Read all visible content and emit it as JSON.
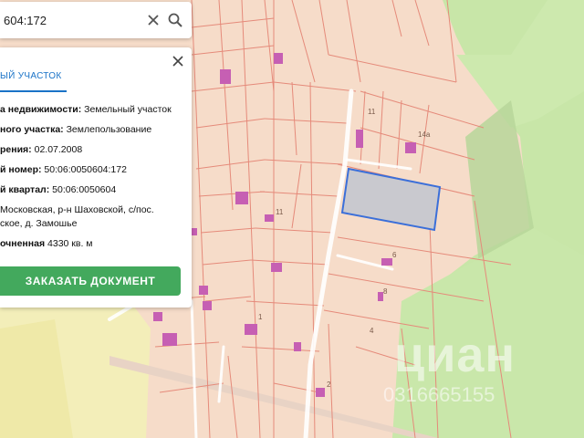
{
  "search": {
    "value": "604:172"
  },
  "card": {
    "tab_label": "ЫЙ УЧАСТОК",
    "rows": [
      {
        "key": "а недвижимости:",
        "value": " Земельный участок"
      },
      {
        "key": "ного участка:",
        "value": " Землепользование"
      },
      {
        "key": "рения:",
        "value": " 02.07.2008"
      },
      {
        "key": "й номер:",
        "value": " 50:06:0050604:172"
      },
      {
        "key": "й квартал:",
        "value": " 50:06:0050604"
      },
      {
        "key": "",
        "value": "Московская, р-н Шаховской, с/пос."
      },
      {
        "key": "",
        "value": "ское, д. Замошье"
      },
      {
        "key": "очненная",
        "value": "  4330 кв. м"
      }
    ],
    "button_label": "ЗАКАЗАТЬ ДОКУМЕНТ"
  },
  "map": {
    "plot_labels": [
      "11",
      "14а",
      "11",
      "6",
      "8",
      "4",
      "1",
      "2"
    ],
    "colors": {
      "parcel_fill": "#f6dcc9",
      "parcel_line": "#e58a7a",
      "building": "#c65fb3",
      "selection": "#3b6fd9",
      "forest": "#c8e6a8",
      "accent_button": "#43a95d",
      "tab_accent": "#1a73c7"
    }
  },
  "watermark": {
    "brand": "циан",
    "phone": "0316665155"
  }
}
